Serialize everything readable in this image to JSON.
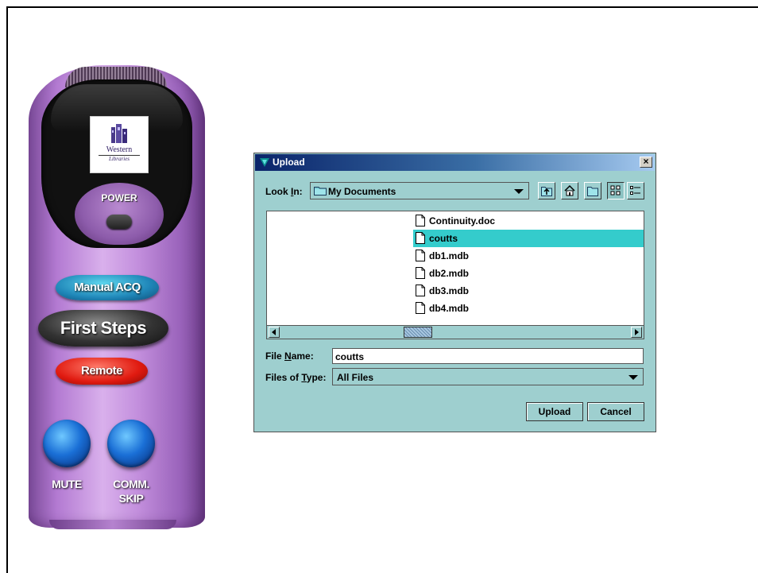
{
  "remote": {
    "logo_line1": "Western",
    "logo_line2": "Libraries",
    "power_label": "POWER",
    "manual_label": "Manual ACQ",
    "first_steps_label": "First Steps",
    "remote_label": "Remote",
    "mute_label": "MUTE",
    "skip_label_line1": "COMM.",
    "skip_label_line2": "SKIP",
    "colors": {
      "body": "#b98ad6",
      "manual": "#1f86b8",
      "first_steps": "#222222",
      "remote": "#e01a10",
      "round_buttons": "#1a6fd6"
    }
  },
  "dialog": {
    "title": "Upload",
    "title_icon": "java-cup-icon",
    "close_label": "×",
    "look_in": {
      "label_pre": "Look ",
      "label_mnemonic": "I",
      "label_post": "n:",
      "value": "My Documents",
      "icon": "folder-icon"
    },
    "toolbar": {
      "up_folder_icon": "up-one-level-icon",
      "home_icon": "home-icon",
      "new_folder_icon": "new-folder-icon",
      "list_view_icon": "list-view-icon",
      "details_view_icon": "details-view-icon"
    },
    "files": [
      {
        "name": "Continuity.doc",
        "selected": false
      },
      {
        "name": "coutts",
        "selected": true
      },
      {
        "name": "db1.mdb",
        "selected": false
      },
      {
        "name": "db2.mdb",
        "selected": false
      },
      {
        "name": "db3.mdb",
        "selected": false
      },
      {
        "name": "db4.mdb",
        "selected": false
      }
    ],
    "file_name": {
      "label_pre": "File ",
      "label_mnemonic": "N",
      "label_post": "ame:",
      "value": "coutts"
    },
    "file_type": {
      "label_pre": "Files of ",
      "label_mnemonic": "T",
      "label_post": "ype:",
      "value": "All Files"
    },
    "upload_label": "Upload",
    "cancel_label": "Cancel",
    "colors": {
      "background": "#9ecfcf",
      "selection": "#34cccc",
      "title_start": "#0a246a",
      "title_end": "#a6caf0"
    }
  }
}
